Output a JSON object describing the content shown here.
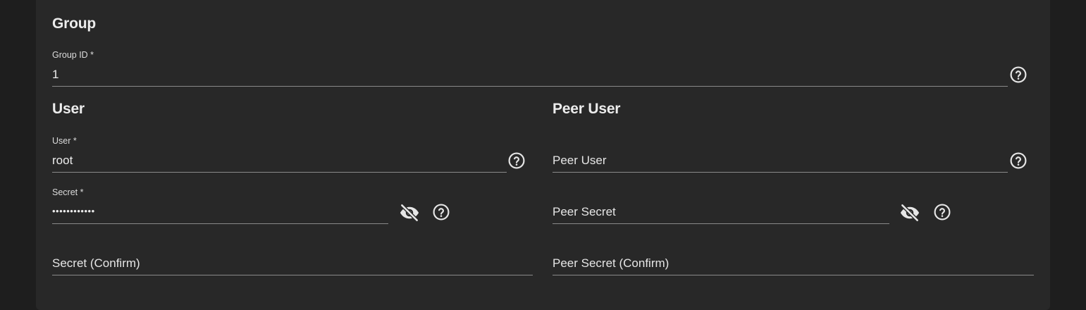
{
  "group": {
    "title": "Group",
    "group_id": {
      "label": "Group ID *",
      "value": "1"
    }
  },
  "user": {
    "title": "User",
    "user": {
      "label": "User *",
      "value": "root"
    },
    "secret": {
      "label": "Secret *",
      "value": "••••••••••••"
    },
    "secret_confirm": {
      "placeholder": "Secret (Confirm)"
    }
  },
  "peer_user": {
    "title": "Peer User",
    "peer_user": {
      "placeholder": "Peer User"
    },
    "peer_secret": {
      "placeholder": "Peer Secret"
    },
    "peer_secret_confirm": {
      "placeholder": "Peer Secret (Confirm)"
    }
  },
  "icons": {
    "help": "help-circle-icon",
    "visibility": "eye-off-icon"
  },
  "colors": {
    "page_background": "#1e1e1e",
    "card_background": "#282828",
    "text": "#e6e6e6",
    "underline": "#8a8a8a"
  }
}
